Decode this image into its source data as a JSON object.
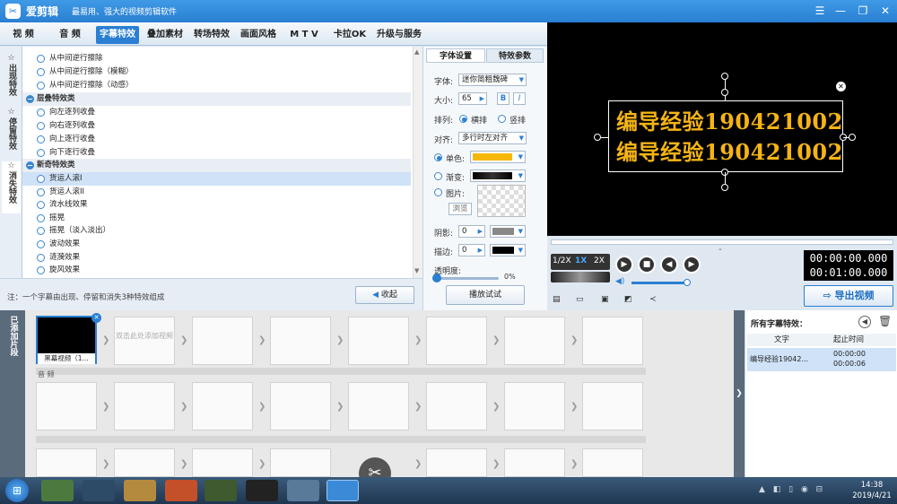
{
  "app": {
    "name": "爱剪辑",
    "slogan": "最易用、强大的视频剪辑软件"
  },
  "tabs": [
    "视  频",
    "音  频",
    "字幕特效",
    "叠加素材",
    "转场特效",
    "画面风格",
    "M T V",
    "卡拉OK",
    "升级与服务"
  ],
  "side_tabs": [
    "出现特效",
    "停留特效",
    "消失特效"
  ],
  "effects": [
    {
      "type": "item",
      "label": "从中间逆行擦除"
    },
    {
      "type": "item",
      "label": "从中间逆行擦除（模糊）"
    },
    {
      "type": "item",
      "label": "从中间逆行擦除（动感）"
    },
    {
      "type": "group",
      "label": "层叠特效类"
    },
    {
      "type": "item",
      "label": "向左逐列收叠"
    },
    {
      "type": "item",
      "label": "向右逐列收叠"
    },
    {
      "type": "item",
      "label": "向上逐行收叠"
    },
    {
      "type": "item",
      "label": "向下逐行收叠"
    },
    {
      "type": "group",
      "label": "新奇特效类"
    },
    {
      "type": "item",
      "label": "货运人滚I",
      "selected": true
    },
    {
      "type": "item",
      "label": "货运人滚II"
    },
    {
      "type": "item",
      "label": "流水线效果"
    },
    {
      "type": "item",
      "label": "摇晃"
    },
    {
      "type": "item",
      "label": "摇晃（淡入淡出）"
    },
    {
      "type": "item",
      "label": "波动效果"
    },
    {
      "type": "item",
      "label": "涟漪效果"
    },
    {
      "type": "item",
      "label": "旋风效果"
    }
  ],
  "note": "注：一个字幕由出现、停留和消失3种特效组成",
  "collapse_label": "收起",
  "settings": {
    "tabs": [
      "字体设置",
      "特效参数"
    ],
    "font_label": "字体:",
    "font_value": "迷你简粗魏碑",
    "size_label": "大小:",
    "size_value": "65",
    "bold": "B",
    "italic": "I",
    "layout_label": "排列:",
    "layout_h": "横排",
    "layout_v": "竖排",
    "align_label": "对齐:",
    "align_value": "多行时左对齐",
    "solid_label": "单色:",
    "solid_color": "#f5b80a",
    "gradient_label": "渐变:",
    "image_label": "图片:",
    "browse_label": "浏览",
    "shadow_label": "阴影:",
    "shadow_value": "0",
    "shadow_color": "#888888",
    "stroke_label": "描边:",
    "stroke_value": "0",
    "stroke_color": "#000000",
    "opacity_label": "透明度:",
    "opacity_value": "0%",
    "play_test": "播放试试"
  },
  "preview": {
    "lines": [
      "编导经验190421002",
      "编导经验190421002"
    ],
    "text_color": "#f5b414"
  },
  "player": {
    "speeds": [
      "1/2X",
      "1X",
      "2X"
    ],
    "time_current": "00:00:00.000",
    "time_total": "00:01:00.000",
    "export_label": "导出视频"
  },
  "storyboard": {
    "added_label": "已添加片段",
    "clip_name": "黑幕视频（1...",
    "placeholder": "双击此处添加视频",
    "music_label": "音 频"
  },
  "captions": {
    "title": "所有字幕特效：",
    "col_text": "文字",
    "col_time": "起止时间",
    "row_text": "编导经验19042...",
    "row_start": "00:00:00",
    "row_end": "00:00:06"
  },
  "clock": {
    "time": "14:38",
    "date": "2019/4/21"
  }
}
